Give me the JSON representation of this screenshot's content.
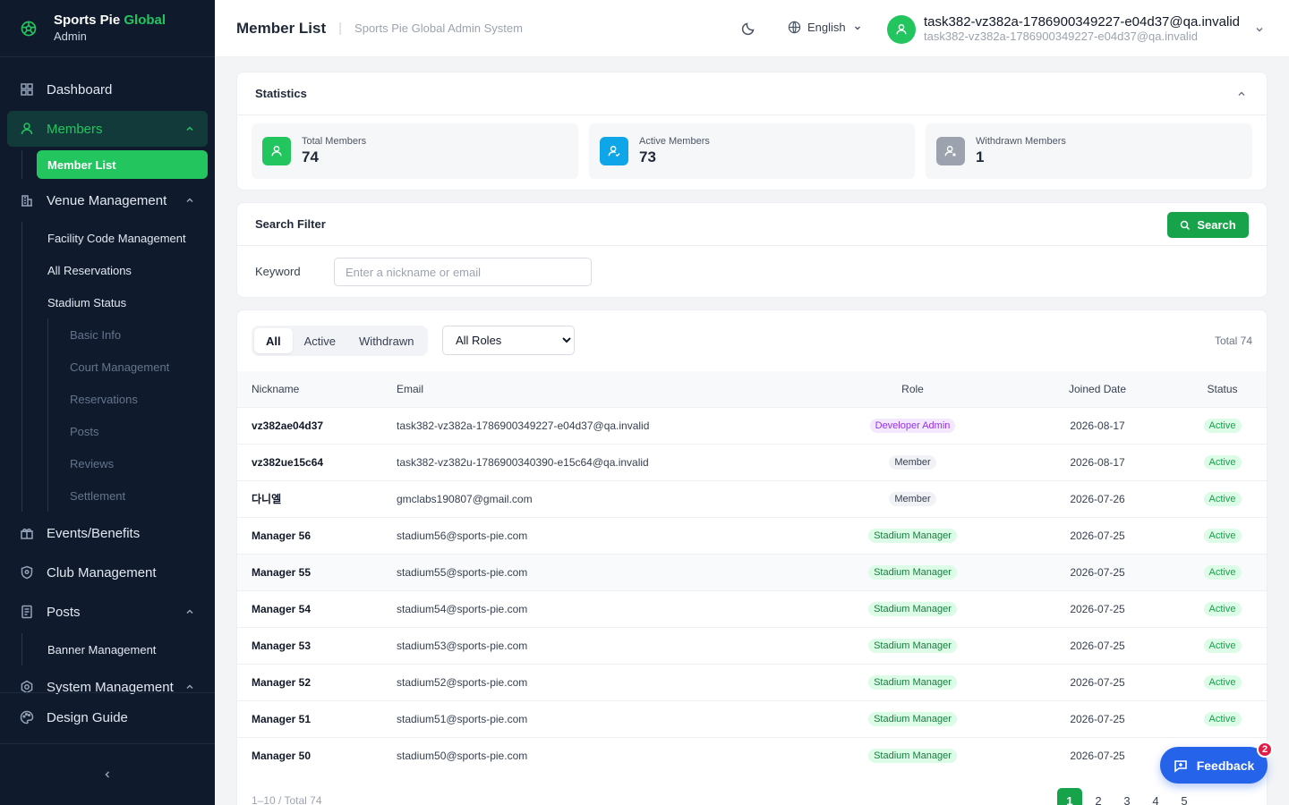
{
  "brand": {
    "name_main": "Sports Pie",
    "name_accent": "Global",
    "role": "Admin",
    "icon": "soccer-ball-icon"
  },
  "sidebar": {
    "dashboard": "Dashboard",
    "members": "Members",
    "member_list": "Member List",
    "venue": "Venue Management",
    "venue_items": [
      "Facility Code Management",
      "All Reservations",
      "Stadium Status"
    ],
    "stadium_items": [
      "Basic Info",
      "Court Management",
      "Reservations",
      "Posts",
      "Reviews",
      "Settlement"
    ],
    "events": "Events/Benefits",
    "club": "Club Management",
    "posts": "Posts",
    "post_items": [
      "Banner Management"
    ],
    "system": "System Management",
    "design_guide": "Design Guide"
  },
  "header": {
    "title": "Member List",
    "system_name": "Sports Pie Global Admin System",
    "language": "English",
    "user_name": "task382-vz382a-1786900349227-e04d37@qa.invalid",
    "user_email": "task382-vz382a-1786900349227-e04d37@qa.invalid"
  },
  "statistics": {
    "title": "Statistics",
    "total_label": "Total Members",
    "total_value": "74",
    "active_label": "Active Members",
    "active_value": "73",
    "withdrawn_label": "Withdrawn Members",
    "withdrawn_value": "1"
  },
  "filter": {
    "title": "Search Filter",
    "search_label": "Search",
    "keyword_label": "Keyword",
    "keyword_placeholder": "Enter a nickname or email",
    "keyword_value": ""
  },
  "list": {
    "tabs": [
      "All",
      "Active",
      "Withdrawn"
    ],
    "selected_tab": "All",
    "role_select": "All Roles",
    "total_text": "Total 74",
    "columns": [
      "Nickname",
      "Email",
      "Role",
      "Joined Date",
      "Status"
    ],
    "rows": [
      {
        "nickname": "vz382ae04d37",
        "email": "task382-vz382a-1786900349227-e04d37@qa.invalid",
        "role": "Developer Admin",
        "date": "2026-08-17",
        "status": "Active"
      },
      {
        "nickname": "vz382ue15c64",
        "email": "task382-vz382u-1786900340390-e15c64@qa.invalid",
        "role": "Member",
        "date": "2026-08-17",
        "status": "Active"
      },
      {
        "nickname": "다니엘",
        "email": "gmclabs190807@gmail.com",
        "role": "Member",
        "date": "2026-07-26",
        "status": "Active"
      },
      {
        "nickname": "Manager 56",
        "email": "stadium56@sports-pie.com",
        "role": "Stadium Manager",
        "date": "2026-07-25",
        "status": "Active"
      },
      {
        "nickname": "Manager 55",
        "email": "stadium55@sports-pie.com",
        "role": "Stadium Manager",
        "date": "2026-07-25",
        "status": "Active"
      },
      {
        "nickname": "Manager 54",
        "email": "stadium54@sports-pie.com",
        "role": "Stadium Manager",
        "date": "2026-07-25",
        "status": "Active"
      },
      {
        "nickname": "Manager 53",
        "email": "stadium53@sports-pie.com",
        "role": "Stadium Manager",
        "date": "2026-07-25",
        "status": "Active"
      },
      {
        "nickname": "Manager 52",
        "email": "stadium52@sports-pie.com",
        "role": "Stadium Manager",
        "date": "2026-07-25",
        "status": "Active"
      },
      {
        "nickname": "Manager 51",
        "email": "stadium51@sports-pie.com",
        "role": "Stadium Manager",
        "date": "2026-07-25",
        "status": "Active"
      },
      {
        "nickname": "Manager 50",
        "email": "stadium50@sports-pie.com",
        "role": "Stadium Manager",
        "date": "2026-07-25",
        "status": ""
      }
    ],
    "footer_range": "1–10 / Total 74",
    "pages": [
      "1",
      "2",
      "3",
      "4",
      "5"
    ],
    "current_page": "1"
  },
  "feedback": {
    "label": "Feedback",
    "count": "2"
  },
  "colors": {
    "brand_green": "#22c55e",
    "primary_green": "#16a34a",
    "sidebar_bg": "#0f1b2d",
    "feedback_blue": "#2563eb",
    "badge_red": "#e11d48"
  }
}
